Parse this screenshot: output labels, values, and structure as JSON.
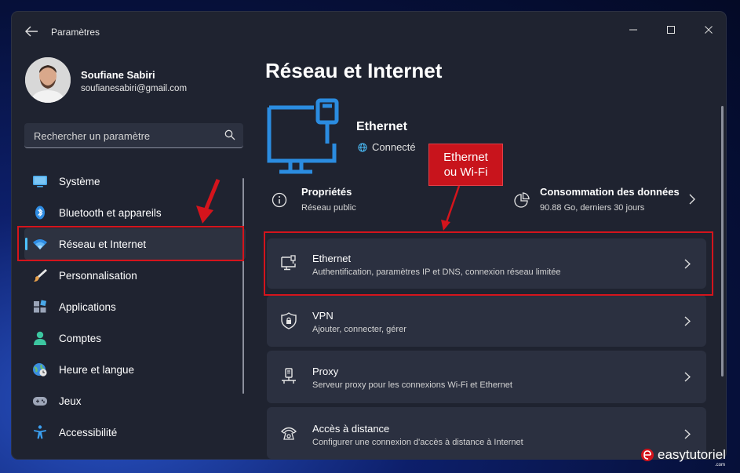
{
  "window": {
    "title": "Paramètres"
  },
  "user": {
    "name": "Soufiane Sabiri",
    "email": "soufianesabiri@gmail.com"
  },
  "search": {
    "placeholder": "Rechercher un paramètre"
  },
  "nav": {
    "items": [
      {
        "label": "Système",
        "icon": "system-icon"
      },
      {
        "label": "Bluetooth et appareils",
        "icon": "bluetooth-icon"
      },
      {
        "label": "Réseau et Internet",
        "icon": "wifi-icon",
        "active": true
      },
      {
        "label": "Personnalisation",
        "icon": "brush-icon"
      },
      {
        "label": "Applications",
        "icon": "apps-icon"
      },
      {
        "label": "Comptes",
        "icon": "account-icon"
      },
      {
        "label": "Heure et langue",
        "icon": "clock-globe-icon"
      },
      {
        "label": "Jeux",
        "icon": "gamepad-icon"
      },
      {
        "label": "Accessibilité",
        "icon": "accessibility-icon"
      }
    ]
  },
  "main": {
    "title": "Réseau et Internet",
    "hero": {
      "title": "Ethernet",
      "status": "Connecté"
    },
    "properties": {
      "title": "Propriétés",
      "sub": "Réseau public"
    },
    "data_usage": {
      "title": "Consommation des données",
      "sub": "90.88 Go, derniers 30 jours"
    },
    "cards": [
      {
        "title": "Ethernet",
        "sub": "Authentification, paramètres IP et DNS, connexion réseau limitée",
        "icon": "ethernet-icon"
      },
      {
        "title": "VPN",
        "sub": "Ajouter, connecter, gérer",
        "icon": "shield-icon"
      },
      {
        "title": "Proxy",
        "sub": "Serveur proxy pour les connexions Wi-Fi et Ethernet",
        "icon": "proxy-icon"
      },
      {
        "title": "Accès à distance",
        "sub": "Configurer une connexion d'accès à distance à Internet",
        "icon": "dialup-icon"
      }
    ]
  },
  "annotation": {
    "line1": "Ethernet",
    "line2": "ou Wi-Fi"
  },
  "watermark": {
    "brand": "easytutoriel",
    "domain": ".com"
  },
  "colors": {
    "accent": "#4cc2ff",
    "highlight": "#d4141c",
    "window_bg": "#1f2330",
    "card_bg": "#2b3040"
  }
}
